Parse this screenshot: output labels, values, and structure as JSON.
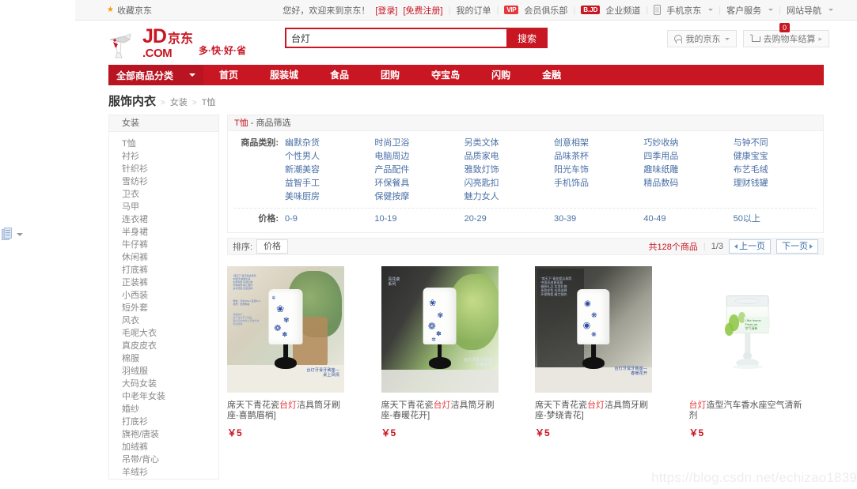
{
  "gutter": {
    "icon": "document-icon"
  },
  "topbar": {
    "favorite": "收藏京东",
    "greeting": "您好，欢迎来到京东！",
    "login": "[登录]",
    "register": "[免费注册]",
    "my_orders": "我的订单",
    "vip_badge": "VIP",
    "vip_club": "会员俱乐部",
    "bjd_badge": "B.JD",
    "enterprise": "企业频道",
    "mobile_jd": "手机京东",
    "customer_service": "客户服务",
    "site_nav": "网站导航"
  },
  "header": {
    "logo_jd": "JD",
    "logo_com": ".COM",
    "logo_cn": "京东",
    "slogan": "多·快·好·省",
    "search_value": "台灯",
    "search_placeholder": "台灯",
    "search_button": "搜索",
    "my_jd": "我的京东",
    "cart": "去购物车结算",
    "cart_count": "0"
  },
  "nav": {
    "all_categories": "全部商品分类",
    "items": [
      "首页",
      "服装城",
      "食品",
      "团购",
      "夺宝岛",
      "闪购",
      "金融"
    ]
  },
  "breadcrumb": {
    "root": "服饰内衣",
    "level2": "女装",
    "level3": "T恤"
  },
  "sidebar": {
    "header": "女装",
    "items": [
      "T恤",
      "衬衫",
      "针织衫",
      "雪纺衫",
      "卫衣",
      "马甲",
      "连衣裙",
      "半身裙",
      "牛仔裤",
      "休闲裤",
      "打底裤",
      "正装裤",
      "小西装",
      "短外套",
      "风衣",
      "毛呢大衣",
      "真皮皮衣",
      "棉服",
      "羽绒服",
      "大码女装",
      "中老年女装",
      "婚纱",
      "打底衫",
      "旗袍/唐装",
      "加绒裤",
      "吊带/背心",
      "羊绒衫"
    ]
  },
  "filter": {
    "title_kw": "T恤",
    "title_rest": " - 商品筛选",
    "category_label": "商品类别:",
    "categories": [
      "幽默杂货",
      "时尚卫浴",
      "另类文体",
      "创意相架",
      "巧妙收纳",
      "与钟不同",
      "个性男人",
      "电脑周边",
      "品质家电",
      "品味茶杯",
      "四季用品",
      "健康宝宝",
      "新潮美容",
      "产品配件",
      "雅致灯饰",
      "阳光车饰",
      "趣味纸雕",
      "布艺毛绒",
      "益智手工",
      "环保餐具",
      "闪亮匙扣",
      "手机饰品",
      "精品数码",
      "理财钱罐",
      "美味厨房",
      "保健按摩",
      "魅力女人"
    ],
    "price_label": "价格:",
    "prices": [
      "0-9",
      "10-19",
      "20-29",
      "30-39",
      "40-49",
      "50以上"
    ]
  },
  "sortbar": {
    "label": "排序:",
    "sort_price": "价格",
    "total": "共128个商品",
    "page_indicator": "1/3",
    "prev": "上一页",
    "next": "下一页"
  },
  "products": [
    {
      "title_pre": "席天下青花瓷",
      "title_kw": "台灯",
      "title_post": "洁具筒牙刷座-喜鹊眉梢]",
      "price": "￥5",
      "image": "blue-white-porcelain-lamp-toothbrush-holder"
    },
    {
      "title_pre": "席天下青花瓷",
      "title_kw": "台灯",
      "title_post": "洁具筒牙刷座-春暖花开]",
      "price": "￥5",
      "image": "blue-white-porcelain-lamp-toothbrush-holder"
    },
    {
      "title_pre": "席天下青花瓷",
      "title_kw": "台灯",
      "title_post": "洁具筒牙刷座-梦绕青花]",
      "price": "￥5",
      "image": "blue-white-porcelain-lamp-toothbrush-holder"
    },
    {
      "title_pre": "",
      "title_kw": "台灯",
      "title_post": "造型汽车香水座空气清新剂",
      "price": "￥5",
      "image": "lemon-air-freshener-jar"
    }
  ],
  "watermark": "https://blog.csdn.net/echizao1839"
}
